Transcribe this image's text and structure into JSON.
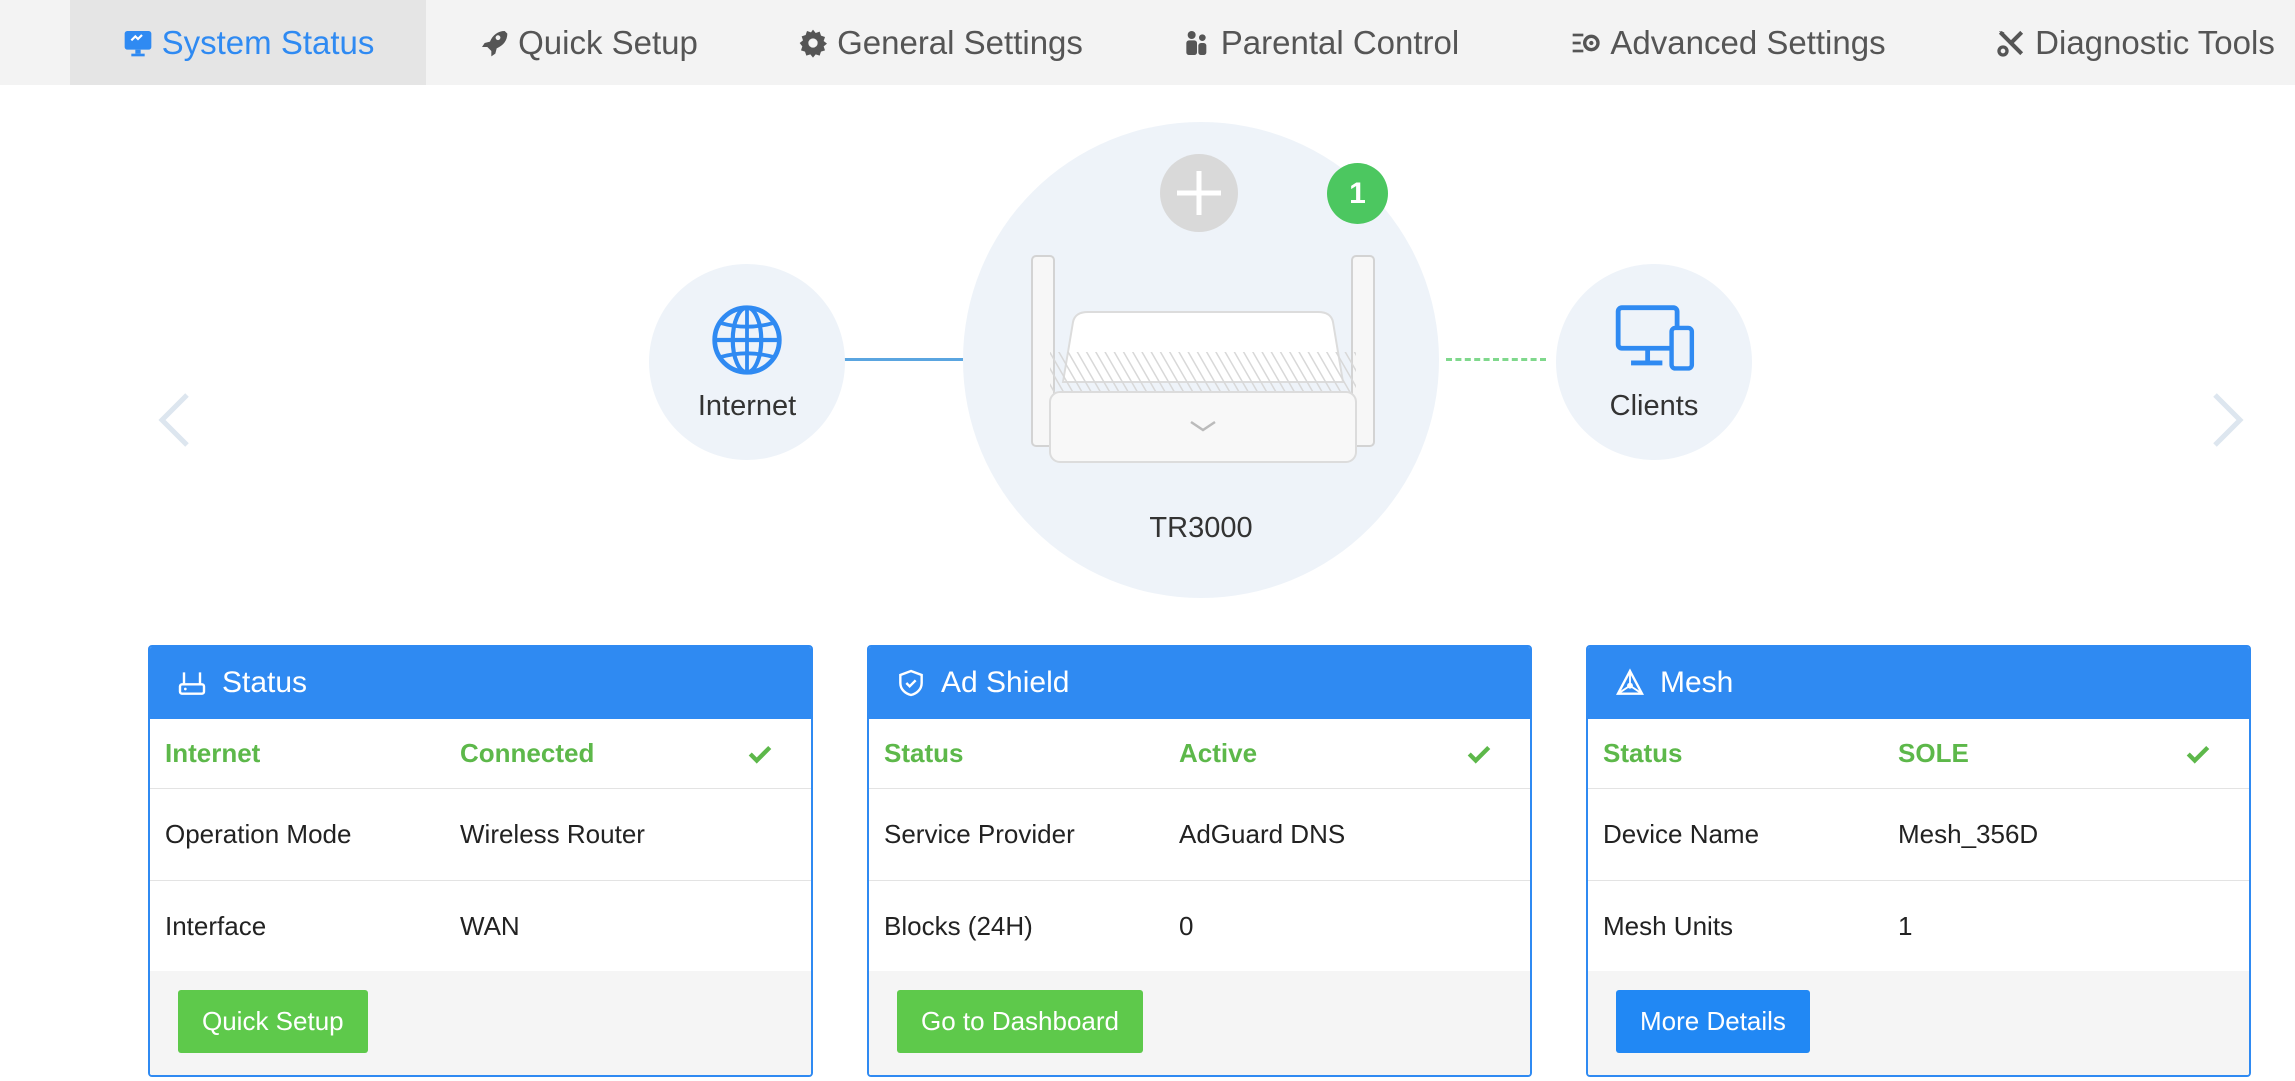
{
  "nav": {
    "tabs": [
      {
        "label": "System Status",
        "icon": "monitor-icon",
        "active": true
      },
      {
        "label": "Quick Setup",
        "icon": "rocket-icon"
      },
      {
        "label": "General Settings",
        "icon": "gear-icon"
      },
      {
        "label": "Parental Control",
        "icon": "family-icon"
      },
      {
        "label": "Advanced Settings",
        "icon": "advanced-settings-icon"
      },
      {
        "label": "Diagnostic Tools",
        "icon": "tools-icon"
      }
    ]
  },
  "topology": {
    "internet_label": "Internet",
    "clients_label": "Clients",
    "router_label": "TR3000",
    "client_count": "1"
  },
  "cards": {
    "status": {
      "title": "Status",
      "rows": [
        {
          "key": "Internet",
          "value": "Connected"
        },
        {
          "key": "Operation Mode",
          "value": "Wireless Router"
        },
        {
          "key": "Interface",
          "value": "WAN"
        }
      ],
      "button": "Quick Setup"
    },
    "adshield": {
      "title": "Ad Shield",
      "rows": [
        {
          "key": "Status",
          "value": "Active"
        },
        {
          "key": "Service Provider",
          "value": "AdGuard DNS"
        },
        {
          "key": "Blocks (24H)",
          "value": "0"
        }
      ],
      "button": "Go to Dashboard"
    },
    "mesh": {
      "title": "Mesh",
      "rows": [
        {
          "key": "Status",
          "value": "SOLE"
        },
        {
          "key": "Device Name",
          "value": "Mesh_356D"
        },
        {
          "key": "Mesh Units",
          "value": "1"
        }
      ],
      "button": "More Details"
    }
  },
  "colors": {
    "accent": "#2f8af2",
    "success": "#5db84a",
    "button_green": "#5ec94b",
    "button_blue": "#2188f4"
  }
}
